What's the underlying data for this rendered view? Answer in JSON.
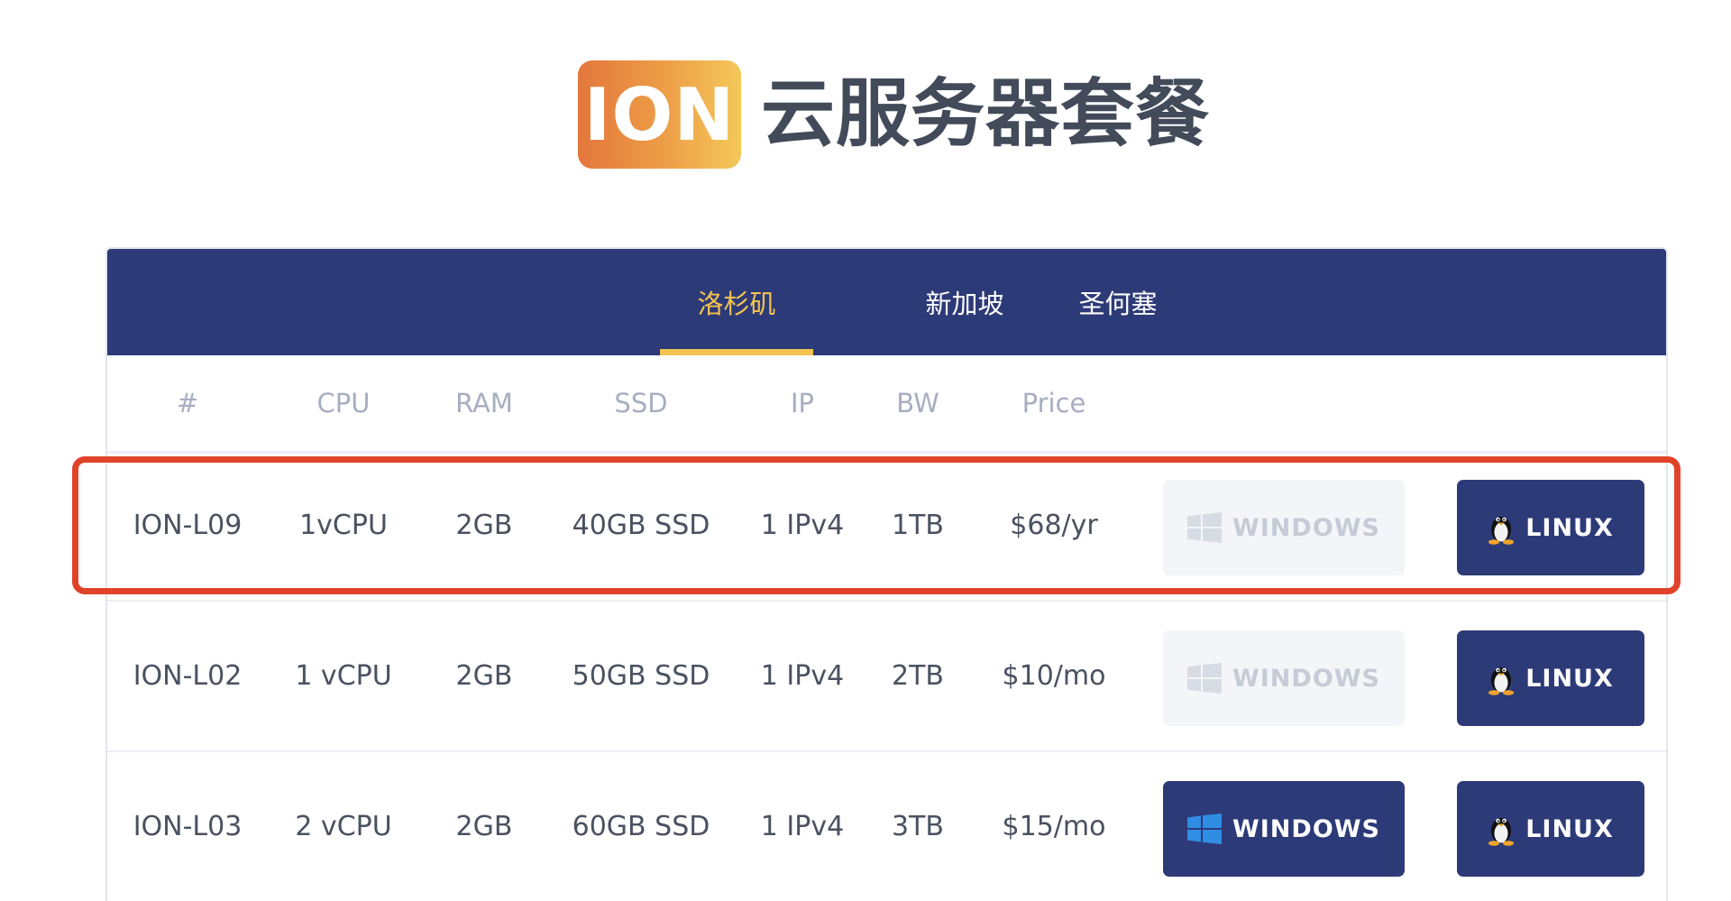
{
  "brand": {
    "logo_text": "ION",
    "title": "云服务器套餐",
    "logo_colors": [
      "#e3773c",
      "#f4c85a"
    ]
  },
  "tabs": [
    {
      "label": "洛杉矶",
      "active": true
    },
    {
      "label": "新加坡",
      "active": false
    },
    {
      "label": "圣何塞",
      "active": false
    }
  ],
  "table": {
    "headers": [
      "#",
      "CPU",
      "RAM",
      "SSD",
      "IP",
      "BW",
      "Price"
    ],
    "rows": [
      {
        "id": "ION-L09",
        "cpu": "1vCPU",
        "ram": "2GB",
        "ssd": "40GB SSD",
        "ip": "1 IPv4",
        "bw": "1TB",
        "price": "$68/yr",
        "windows_enabled": false,
        "linux_enabled": true,
        "highlighted": true
      },
      {
        "id": "ION-L02",
        "cpu": "1 vCPU",
        "ram": "2GB",
        "ssd": "50GB SSD",
        "ip": "1 IPv4",
        "bw": "2TB",
        "price": "$10/mo",
        "windows_enabled": false,
        "linux_enabled": true,
        "highlighted": false
      },
      {
        "id": "ION-L03",
        "cpu": "2 vCPU",
        "ram": "2GB",
        "ssd": "60GB SSD",
        "ip": "1 IPv4",
        "bw": "3TB",
        "price": "$15/mo",
        "windows_enabled": true,
        "linux_enabled": true,
        "highlighted": false
      }
    ]
  },
  "buttons": {
    "windows_label": "WINDOWS",
    "linux_label": "LINUX",
    "windows_icon": "windows-logo-icon",
    "linux_icon": "tux-penguin-icon"
  },
  "colors": {
    "navy": "#2d3a78",
    "accent_yellow": "#f3c34f",
    "highlight_red": "#e0432a",
    "disabled_bg": "#f4f5f8"
  }
}
